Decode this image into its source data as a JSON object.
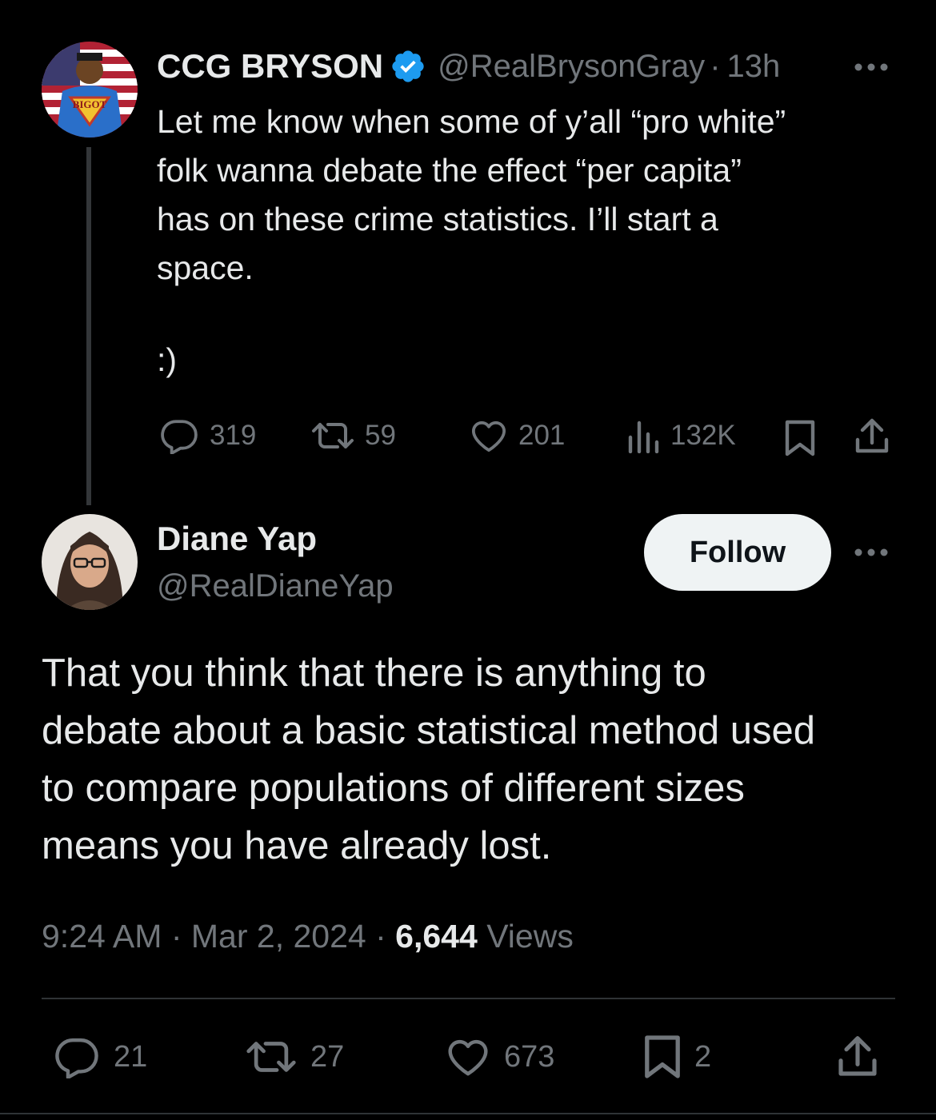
{
  "tweet1": {
    "display_name": "CCG BRYSON",
    "handle": "@RealBrysonGray",
    "sep": "·",
    "age": "13h",
    "avatar_badge": "BIGOT",
    "lines": [
      "Let me know when some of y’all “pro white”",
      "folk wanna debate the effect “per capita”",
      "has on these crime statistics. I’ll start a",
      "space."
    ],
    "smiley": ":)",
    "replies": "319",
    "reposts": "59",
    "likes": "201",
    "views": "132K"
  },
  "tweet2": {
    "display_name": "Diane Yap",
    "handle": "@RealDianeYap",
    "follow_label": "Follow",
    "lines": [
      "That you think that there is anything to",
      "debate about a basic statistical method used",
      "to compare populations of different sizes",
      "means you have already lost."
    ],
    "time": "9:24 AM",
    "date": "Mar 2, 2024",
    "sep": "·",
    "views_count": "6,644",
    "views_label": "Views",
    "replies": "21",
    "reposts": "27",
    "likes": "673",
    "bookmarks": "2"
  },
  "colors": {
    "background": "#000000",
    "text": "#e7e9ea",
    "muted": "#71767b",
    "verified": "#1d9bf0",
    "follow_bg": "#eff3f4"
  }
}
